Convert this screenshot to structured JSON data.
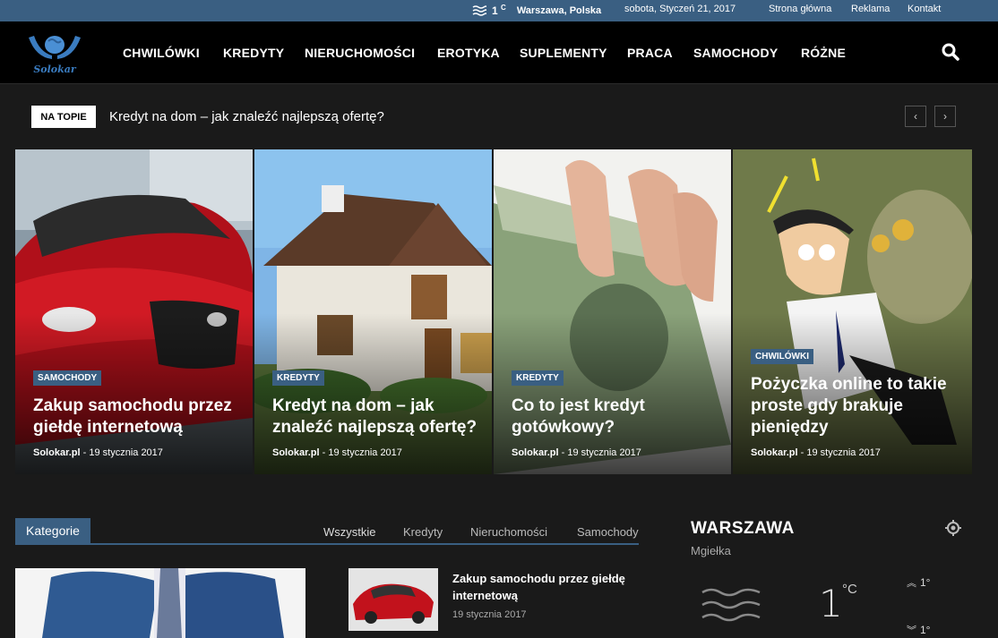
{
  "topbar": {
    "temp": "1",
    "temp_unit": "C",
    "city": "Warszawa, Polska",
    "date": "sobota, Styczeń 21, 2017",
    "links": [
      "Strona główna",
      "Reklama",
      "Kontakt"
    ]
  },
  "header": {
    "logo_text": "Solokar",
    "nav": [
      "CHWILÓWKI",
      "KREDYTY",
      "NIERUCHOMOŚCI",
      "EROTYKA",
      "SUPLEMENTY",
      "PRACA",
      "SAMOCHODY",
      "RÓŻNE"
    ]
  },
  "ticker": {
    "badge": "NA TOPIE",
    "headline": "Kredyt na dom – jak znaleźć najlepszą ofertę?",
    "prev": "‹",
    "next": "›"
  },
  "featured": [
    {
      "category": "SAMOCHODY",
      "title": "Zakup samochodu przez giełdę internetową",
      "author": "Solokar.pl",
      "date": "19 stycznia 2017"
    },
    {
      "category": "KREDYTY",
      "title": "Kredyt na dom – jak znaleźć najlepszą ofertę?",
      "author": "Solokar.pl",
      "date": "19 stycznia 2017"
    },
    {
      "category": "KREDYTY",
      "title": "Co to jest kredyt gotówkowy?",
      "author": "Solokar.pl",
      "date": "19 stycznia 2017"
    },
    {
      "category": "CHWILÓWKI",
      "title": "Pożyczka online to takie proste gdy brakuje pieniędzy",
      "author": "Solokar.pl",
      "date": "19 stycznia 2017"
    }
  ],
  "categories_block": {
    "label": "Kategorie",
    "tabs": [
      "Wszystkie",
      "Kredyty",
      "Nieruchomości",
      "Samochody"
    ]
  },
  "posts": [
    {
      "title": "Zakup samochodu przez giełdę internetową",
      "date": "19 stycznia 2017"
    }
  ],
  "weather_widget": {
    "city": "WARSZAWA",
    "condition": "Mgiełka",
    "temp": "1",
    "unit": "°C",
    "high": "1°",
    "low": "1°"
  },
  "colors": {
    "accent": "#3a5f82",
    "background": "#1a1a1a",
    "header": "#000000"
  }
}
